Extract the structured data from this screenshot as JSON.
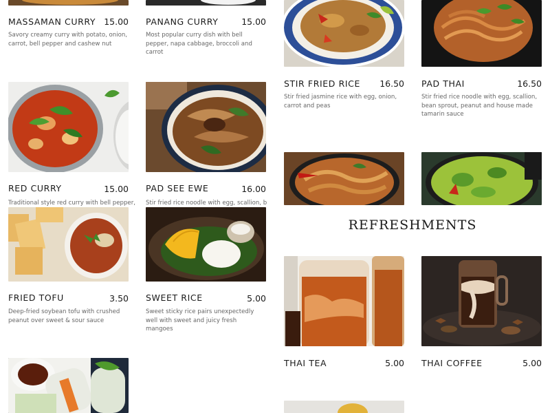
{
  "menu": {
    "massaman": {
      "name": "MASSAMAN CURRY",
      "price": "15.00",
      "desc": "Savory creamy curry with potato, onion, carrot, bell pepper and cashew nut"
    },
    "panang": {
      "name": "PANANG CURRY",
      "price": "15.00",
      "desc": "Most popular curry dish with bell pepper, napa cabbage, broccoli and carrot"
    },
    "red_curry": {
      "name": "RED CURRY",
      "price": "15.00",
      "desc": "Traditional style red curry with bell pepper,"
    },
    "pad_see_ewe": {
      "name": "PAD SEE EWE",
      "price": "16.00",
      "desc": "Stir fried rice noodle with egg, scallion, bean"
    },
    "fried_tofu": {
      "name": "FRIED TOFU",
      "price": "3.50",
      "desc": " Deep-fried soybean tofu with crushed peanut over sweet & sour sauce"
    },
    "sweet_rice": {
      "name": "SWEET RICE",
      "price": "5.00",
      "desc": "Sweet sticky rice pairs unexpectedly well with sweet and juicy fresh mangoes"
    },
    "stir_fried_rice": {
      "name": "STIR FRIED RICE",
      "price": "16.50",
      "desc": "Stir fried jasmine rice with egg, onion, carrot and peas"
    },
    "pad_thai": {
      "name": "PAD THAI",
      "price": "16.50",
      "desc": "Stir fried rice noodle with egg, scallion, bean sprout, peanut and house made tamarin sauce"
    },
    "thai_tea": {
      "name": "THAI TEA",
      "price": "5.00"
    },
    "thai_coffee": {
      "name": "THAI COFFEE",
      "price": "5.00"
    }
  },
  "sections": {
    "refreshments": "REFRESHMENTS"
  }
}
